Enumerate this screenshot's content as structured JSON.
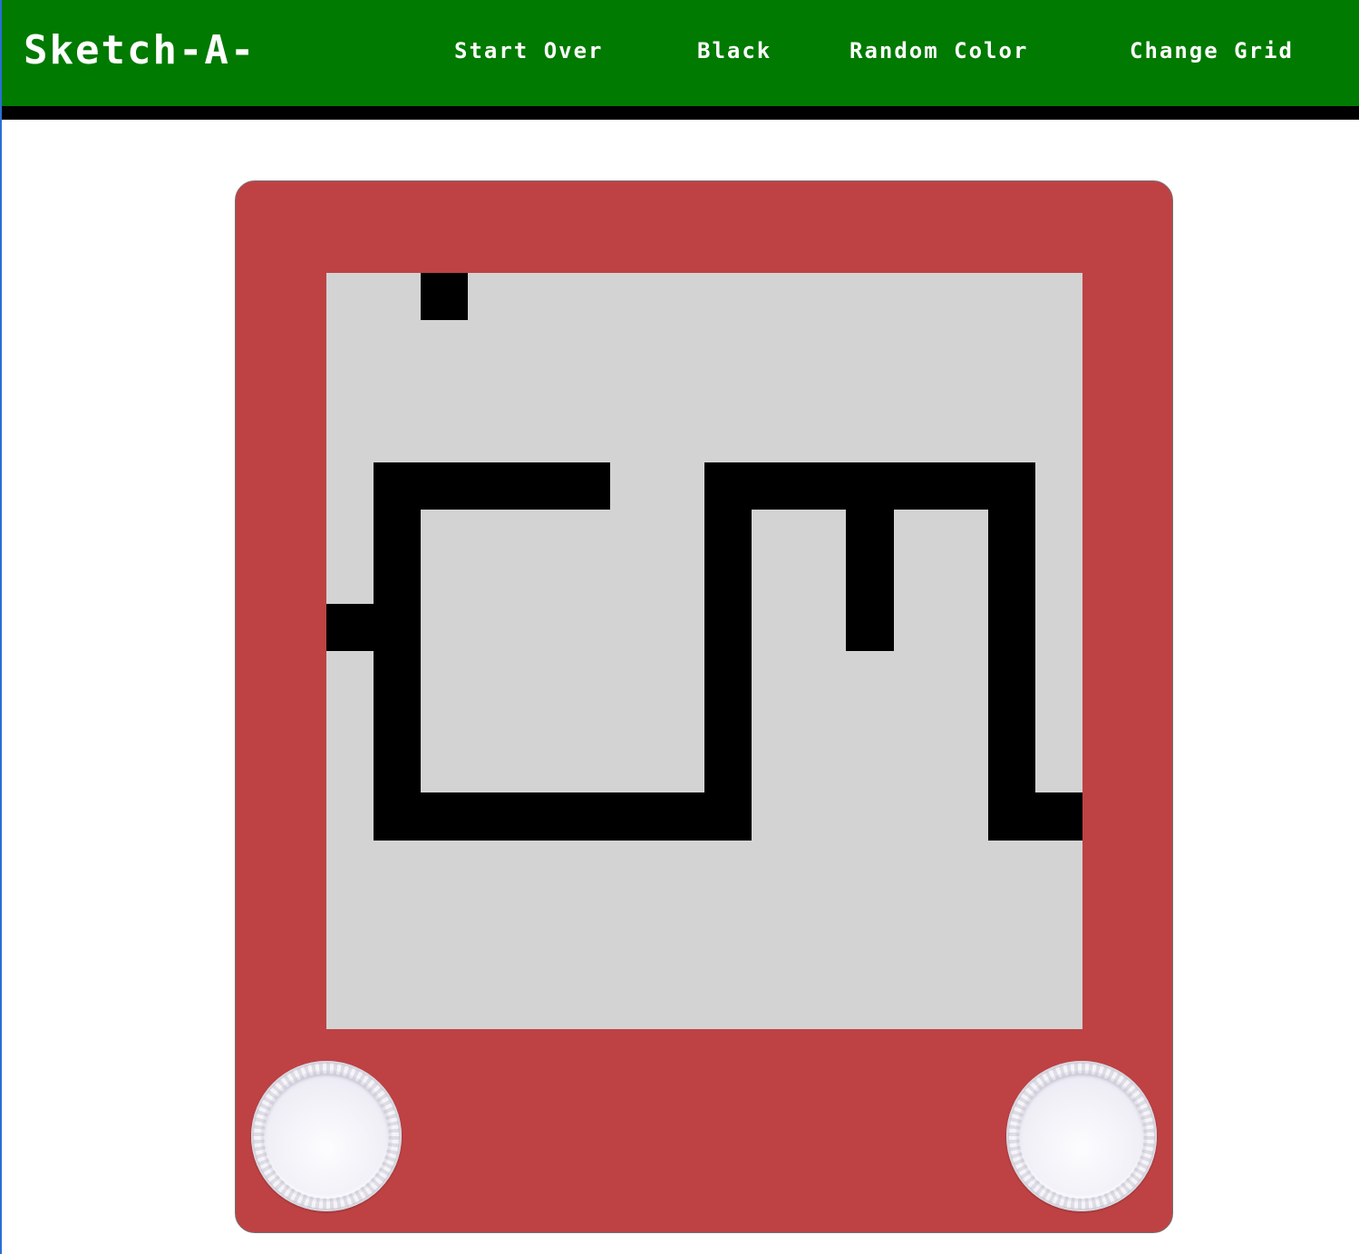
{
  "header": {
    "logo": "Sketch-A-",
    "nav": [
      {
        "label": "Start Over"
      },
      {
        "label": "Black"
      },
      {
        "label": "Random Color"
      },
      {
        "label": "Change Grid"
      }
    ]
  },
  "colors": {
    "header_bg": "#007a00",
    "frame_red": "#be4244",
    "screen_gray": "#d3d3d3",
    "pen": "#000000"
  },
  "board": {
    "grid_size": 16,
    "filled_cells": [
      [
        0,
        2
      ],
      [
        4,
        1
      ],
      [
        4,
        2
      ],
      [
        4,
        3
      ],
      [
        4,
        4
      ],
      [
        4,
        5
      ],
      [
        4,
        8
      ],
      [
        4,
        9
      ],
      [
        4,
        10
      ],
      [
        4,
        11
      ],
      [
        4,
        12
      ],
      [
        4,
        13
      ],
      [
        4,
        14
      ],
      [
        5,
        1
      ],
      [
        5,
        8
      ],
      [
        5,
        11
      ],
      [
        5,
        14
      ],
      [
        6,
        1
      ],
      [
        6,
        8
      ],
      [
        6,
        11
      ],
      [
        6,
        14
      ],
      [
        7,
        0
      ],
      [
        7,
        1
      ],
      [
        7,
        8
      ],
      [
        7,
        11
      ],
      [
        7,
        14
      ],
      [
        8,
        1
      ],
      [
        8,
        8
      ],
      [
        8,
        14
      ],
      [
        9,
        1
      ],
      [
        9,
        8
      ],
      [
        9,
        14
      ],
      [
        10,
        1
      ],
      [
        10,
        8
      ],
      [
        10,
        14
      ],
      [
        11,
        1
      ],
      [
        11,
        2
      ],
      [
        11,
        3
      ],
      [
        11,
        4
      ],
      [
        11,
        5
      ],
      [
        11,
        6
      ],
      [
        11,
        7
      ],
      [
        11,
        8
      ],
      [
        11,
        14
      ],
      [
        11,
        15
      ]
    ]
  },
  "knobs": [
    {
      "name": "left-knob"
    },
    {
      "name": "right-knob"
    }
  ]
}
